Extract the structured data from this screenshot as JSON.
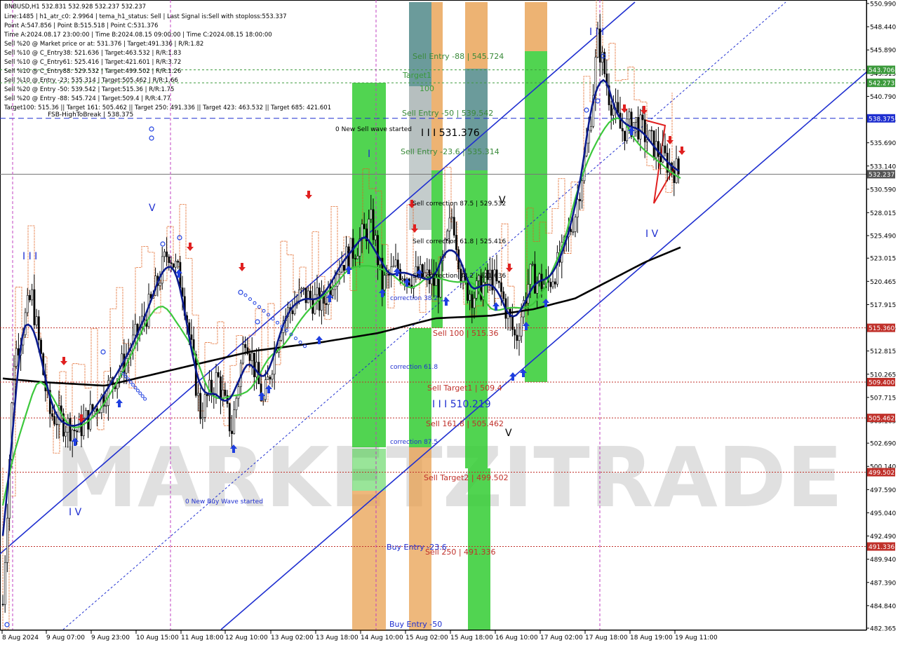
{
  "header": {
    "symbol_line": "BNBUSD,H1  532.831 532.928 532.237 532.237",
    "info_lines": [
      "Line:1485 | h1_atr_c0: 2.9964 | tema_h1_status: Sell | Last Signal is:Sell with stoploss:553.337",
      "Point A:547.856 | Point B:515.518 | Point C:531.376",
      "Time A:2024.08.17 23:00:00 | Time B:2024.08.15 09:00:00 | Time C:2024.08.15 18:00:00",
      "Sell %20 @ Market price or at: 531.376 | Target:491.336 | R/R:1.82",
      "Sell %10 @ C_Entry38: 521.636 | Target:463.532 | R/R:1.83",
      "Sell %10 @ C_Entry61: 525.416 | Target:421.601 | R/R:3.72",
      "Sell %10 @ C_Entry88: 529.532 | Target:499.502 | R/R:1.26",
      "Sell %10 @ Entry -23: 535.314 | Target:505.462 | R/R:1.66",
      "Sell %20 @ Entry -50: 539.542 | Target:515.36 | R/R:1.75",
      "Sell %20 @ Entry -88: 545.724 | Target:509.4 | R/R:4.77",
      "Target100: 515.36 || Target 161: 505.462 || Target 250: 491.336 || Target 423: 463.532 || Target 685: 421.601"
    ]
  },
  "watermark": "MARKETZITRADE",
  "y_axis_ticks": [
    "550.990",
    "548.440",
    "545.890",
    "543.315",
    "540.790",
    "538.215",
    "535.690",
    "533.140",
    "530.590",
    "528.015",
    "525.490",
    "523.015",
    "520.465",
    "517.915",
    "515.365",
    "512.815",
    "510.265",
    "507.715",
    "505.165",
    "502.690",
    "500.140",
    "497.590",
    "495.040",
    "492.490",
    "489.940",
    "487.390",
    "484.840",
    "482.365"
  ],
  "x_axis_ticks": [
    "8 Aug 2024",
    "9 Aug 07:00",
    "9 Aug 23:00",
    "10 Aug 15:00",
    "11 Aug 18:00",
    "12 Aug 10:00",
    "13 Aug 02:00",
    "13 Aug 18:00",
    "14 Aug 10:00",
    "15 Aug 02:00",
    "15 Aug 18:00",
    "16 Aug 10:00",
    "17 Aug 02:00",
    "17 Aug 18:00",
    "18 Aug 19:00",
    "19 Aug 11:00"
  ],
  "price_tags": [
    {
      "label": "543.706",
      "color": "#3c9a3c"
    },
    {
      "label": "542.273",
      "color": "#3c9a3c"
    },
    {
      "label": "538.375",
      "color": "#1f2fd0"
    },
    {
      "label": "532.237",
      "color": "#555555"
    },
    {
      "label": "515.360",
      "color": "#c0302a"
    },
    {
      "label": "509.400",
      "color": "#c0302a"
    },
    {
      "label": "505.462",
      "color": "#c0302a"
    },
    {
      "label": "499.502",
      "color": "#c0302a"
    },
    {
      "label": "491.336",
      "color": "#c0302a"
    }
  ],
  "annotations": {
    "fsb": "FSB-HighToBreak | 538.375",
    "sell_wave": "0 New Sell wave started",
    "buy_wave": "0 New Buy Wave started",
    "sell_entry_88": "Sell Entry -88 | 545.724",
    "target1": "Target1",
    "t100": "100",
    "sell_entry_50": "Sell Entry -50 | 539.542",
    "point_c": "I I I 531.376",
    "sell_entry_23": "Sell Entry -23.6 | 535.314",
    "sell_corr_875": "Sell correction 87.5 | 529.532",
    "sell_corr_618": "Sell correction 61.8 | 525.416",
    "sell_corr_382": "Sell correction 38.2 | 521.636",
    "sell_100": "Sell 100 | 515.36",
    "sell_target1": "Sell Target1 | 509.4",
    "point_b": "I I I 510.219",
    "sell_161": "Sell 161.8 | 505.462",
    "sell_target2": "Sell Target2 | 499.502",
    "sell_250": "Sell 250 | 491.336",
    "buy_entry_236": "Buy Entry -23.6",
    "buy_entry_50": "Buy Entry -50",
    "corr_382": "correction 38.2",
    "corr_618": "correction 61.8",
    "corr_875": "correction 87.5",
    "wave_I": "I",
    "wave_II": "I I",
    "wave_III": "I I I",
    "wave_IV": "I V",
    "wave_V": "V"
  },
  "colors": {
    "bull_candle": "#000000",
    "ma_black": "#000000",
    "ma_navy": "#0a1a8c",
    "ma_green": "#3cc83c",
    "channel": "#1f2fd0",
    "red": "#c0302a",
    "orange_step": "#e06020",
    "green_zone": "#33cc33",
    "orange_zone": "#e8a050"
  },
  "chart_data": {
    "type": "candlestick",
    "symbol": "BNBUSD",
    "timeframe": "H1",
    "ylim": [
      482.365,
      550.99
    ],
    "points": {
      "A": 547.856,
      "B": 515.518,
      "C": 531.376
    },
    "levels": [
      {
        "name": "Sell Entry -88",
        "value": 545.724
      },
      {
        "name": "Sell Entry -50",
        "value": 539.542
      },
      {
        "name": "FSB-HighToBreak",
        "value": 538.375
      },
      {
        "name": "Sell Entry -23.6",
        "value": 535.314
      },
      {
        "name": "Sell correction 87.5",
        "value": 529.532
      },
      {
        "name": "Sell correction 61.8",
        "value": 525.416
      },
      {
        "name": "Sell correction 38.2",
        "value": 521.636
      },
      {
        "name": "Sell 100",
        "value": 515.36
      },
      {
        "name": "Sell Target1",
        "value": 509.4
      },
      {
        "name": "Sell 161.8",
        "value": 505.462
      },
      {
        "name": "Sell Target2",
        "value": 499.502
      },
      {
        "name": "Sell 250",
        "value": 491.336
      }
    ],
    "last_price": 532.237
  }
}
